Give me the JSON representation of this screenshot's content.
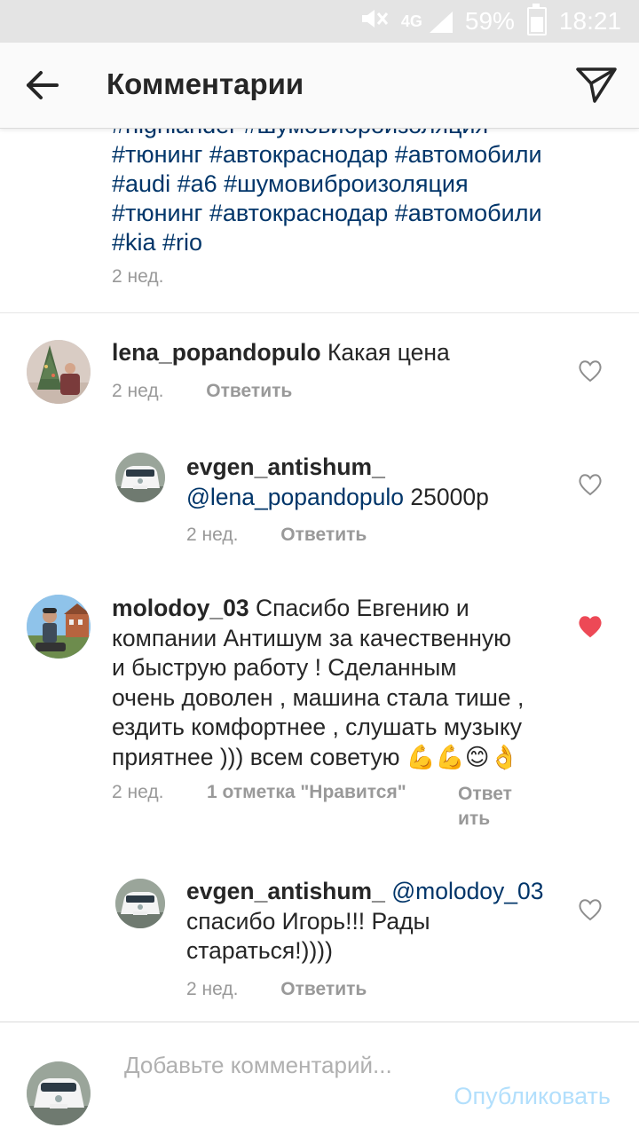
{
  "status_bar": {
    "network": "4G",
    "battery": "59%",
    "time": "18:21",
    "battery_level": 0.59
  },
  "header": {
    "title": "Комментарии",
    "back_icon": "arrow-left-icon",
    "share_icon": "paper-plane-icon"
  },
  "caption": {
    "lines": [
      "#highlander #шумовиброизоляция",
      "#тюнинг #автокраснодар #автомобили",
      "#audi #a6 #шумовиброизоляция",
      "#тюнинг #автокраснодар #автомобили",
      "#kia #rio"
    ],
    "time": "2 нед."
  },
  "comments": [
    {
      "username": "lena_popandopulo",
      "text": "Какая цена",
      "time": "2 нед.",
      "reply_label": "Ответить",
      "liked": false,
      "replies": [
        {
          "username": "evgen_antishum_",
          "mention": "@lena_popandopulo",
          "text": "25000р",
          "time": "2 нед.",
          "reply_label": "Ответить",
          "liked": false
        }
      ]
    },
    {
      "username": "molodoy_03",
      "text_lines": [
        "Спасибо Евгению и",
        "компании Антишум за качественную",
        "и быструю работу !  Сделанным",
        "очень доволен , машина стала тише ,",
        "ездить комфортнее , слушать музыку",
        "приятнее ))) всем советую 💪💪😊👌"
      ],
      "time": "2 нед.",
      "likes_label": "1 отметка \"Нравится\"",
      "reply_label_lines": [
        "Ответ",
        "ить"
      ],
      "liked": true,
      "replies": [
        {
          "username": "evgen_antishum_",
          "mention": "@molodoy_03",
          "text_lines": [
            "спасибо Игорь!!! Рады",
            "стараться!))))"
          ],
          "time": "2 нед.",
          "reply_label": "Ответить",
          "liked": false
        }
      ]
    }
  ],
  "composer": {
    "placeholder": "Добавьте комментарий...",
    "publish_label": "Опубликовать"
  },
  "colors": {
    "mention": "#003569",
    "heart_liked": "#ed4956",
    "meta": "#999999",
    "publish_disabled": "#b2dffc"
  }
}
